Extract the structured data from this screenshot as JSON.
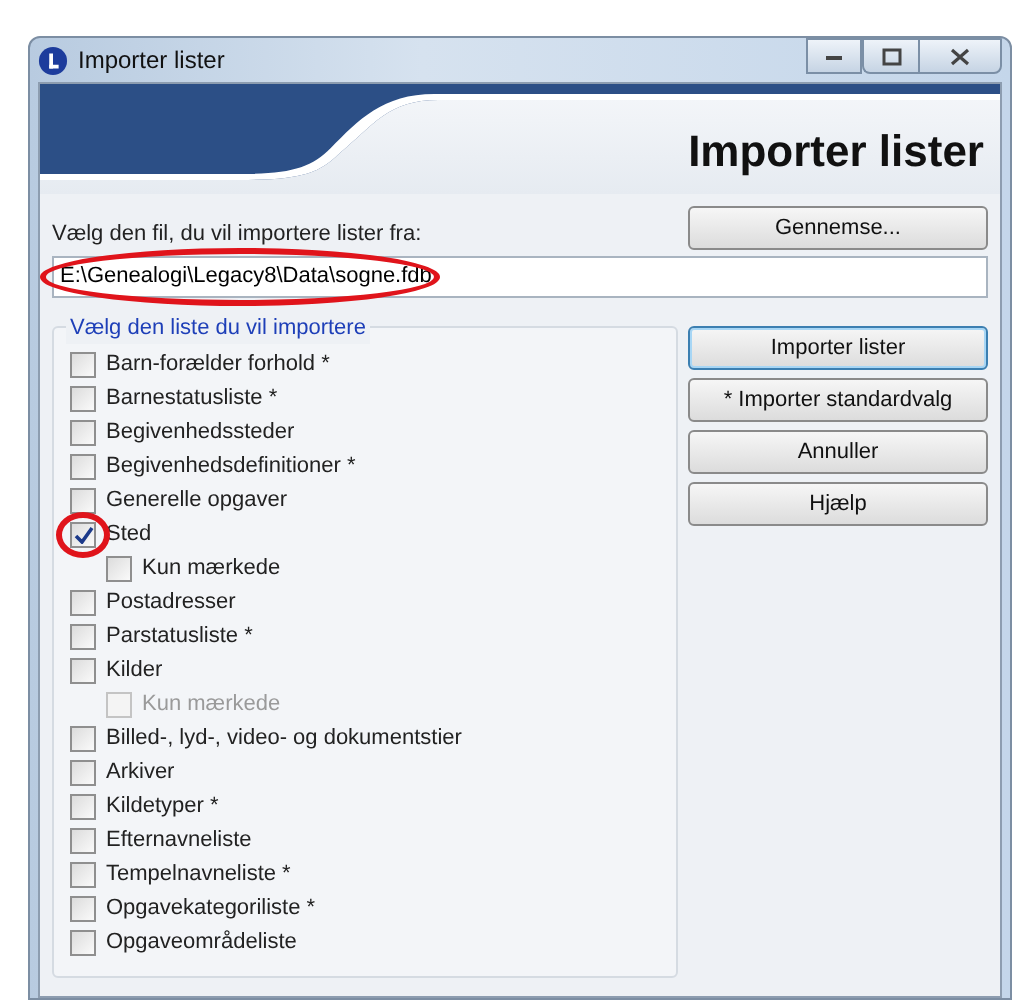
{
  "window": {
    "title": "Importer lister"
  },
  "header": {
    "title": "Importer lister"
  },
  "file": {
    "label": "Vælg den fil, du vil importere lister fra:",
    "value": "E:\\Genealogi\\Legacy8\\Data\\sogne.fdb",
    "circled": true
  },
  "browse_button": "Gennemse...",
  "group": {
    "label": "Vælg den liste du vil importere"
  },
  "lists": [
    {
      "label": "Barn-forælder forhold *",
      "checked": false
    },
    {
      "label": "Barnestatusliste *",
      "checked": false
    },
    {
      "label": "Begivenhedssteder",
      "checked": false
    },
    {
      "label": "Begivenhedsdefinitioner *",
      "checked": false
    },
    {
      "label": "Generelle opgaver",
      "checked": false
    },
    {
      "label": "Sted",
      "checked": true,
      "circled": true,
      "children": [
        {
          "label": "Kun mærkede",
          "checked": false,
          "disabled": false
        }
      ]
    },
    {
      "label": "Postadresser",
      "checked": false
    },
    {
      "label": "Parstatusliste *",
      "checked": false
    },
    {
      "label": "Kilder",
      "checked": false,
      "children": [
        {
          "label": "Kun mærkede",
          "checked": false,
          "disabled": true
        }
      ]
    },
    {
      "label": "Billed-, lyd-, video- og dokumentstier",
      "checked": false
    },
    {
      "label": "Arkiver",
      "checked": false
    },
    {
      "label": "Kildetyper *",
      "checked": false
    },
    {
      "label": "Efternavneliste",
      "checked": false
    },
    {
      "label": "Tempelnavneliste *",
      "checked": false
    },
    {
      "label": "Opgavekategoriliste *",
      "checked": false
    },
    {
      "label": "Opgaveområdeliste",
      "checked": false
    }
  ],
  "buttons": [
    {
      "label": "Importer lister",
      "default": true
    },
    {
      "label": "* Importer standardvalg",
      "default": false
    },
    {
      "label": "Annuller",
      "default": false
    },
    {
      "label": "Hjælp",
      "default": false
    }
  ]
}
